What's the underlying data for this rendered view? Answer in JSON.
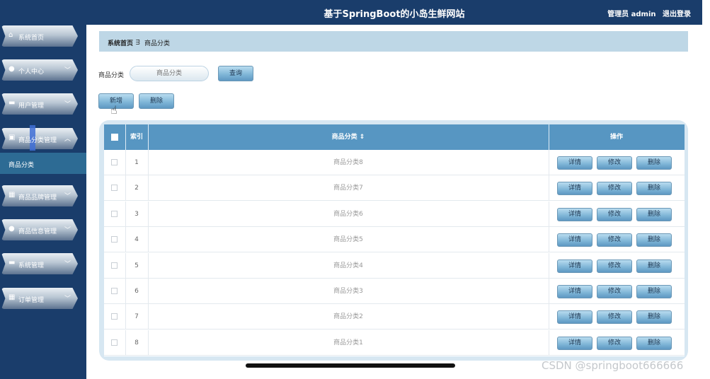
{
  "header": {
    "title": "基于SpringBoot的小岛生鲜网站",
    "role_label": "管理员 admin",
    "logout_label": "退出登录"
  },
  "sidebar": {
    "items": [
      {
        "label": "系统首页",
        "icon": "home-icon",
        "glyph": "⌂",
        "has_chevron": false
      },
      {
        "label": "个人中心",
        "icon": "user-icon",
        "glyph": "●",
        "has_chevron": true
      },
      {
        "label": "用户管理",
        "icon": "monitor-icon",
        "glyph": "▬",
        "has_chevron": true
      },
      {
        "label": "商品分类管理",
        "icon": "clipboard-icon",
        "glyph": "▣",
        "has_chevron": true,
        "expanded": true
      },
      {
        "label": "商品品牌管理",
        "icon": "grid-icon",
        "glyph": "▦",
        "has_chevron": true
      },
      {
        "label": "商品信息管理",
        "icon": "user-icon",
        "glyph": "●",
        "has_chevron": true
      },
      {
        "label": "系统管理",
        "icon": "tv-icon",
        "glyph": "▬",
        "has_chevron": true
      },
      {
        "label": "订单管理",
        "icon": "grid-icon",
        "glyph": "▦",
        "has_chevron": true
      }
    ],
    "submenu_active": "商品分类"
  },
  "breadcrumb": {
    "home": "系统首页",
    "separator": "ᴟ",
    "current": "商品分类"
  },
  "search": {
    "label": "商品分类",
    "placeholder": "商品分类",
    "button": "查询"
  },
  "actions": {
    "add": "新增",
    "delete": "删除"
  },
  "table": {
    "columns": [
      "",
      "索引",
      "商品分类 ⇕",
      "操作"
    ],
    "rows": [
      {
        "index": "1",
        "category": "商品分类8"
      },
      {
        "index": "2",
        "category": "商品分类7"
      },
      {
        "index": "3",
        "category": "商品分类6"
      },
      {
        "index": "4",
        "category": "商品分类5"
      },
      {
        "index": "5",
        "category": "商品分类4"
      },
      {
        "index": "6",
        "category": "商品分类3"
      },
      {
        "index": "7",
        "category": "商品分类2"
      },
      {
        "index": "8",
        "category": "商品分类1"
      }
    ],
    "row_buttons": {
      "detail": "详情",
      "edit": "修改",
      "delete": "删除"
    }
  },
  "watermark": "CSDN @springboot666666",
  "colors": {
    "nav_bg": "#1a3d6b",
    "table_header": "#5796c2",
    "breadcrumb_bg": "#bed7e6",
    "button": "#7db4d6"
  }
}
